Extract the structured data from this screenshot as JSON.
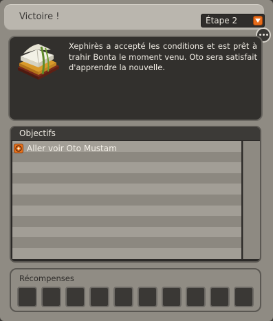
{
  "window": {
    "title": "Victoire !",
    "step_selected": "Étape 2",
    "more_icon": "ellipsis-icon",
    "accent": "#e8731d"
  },
  "description": {
    "icon": "book-icon",
    "text": "Xephirès a accepté les conditions et est prêt à trahir Bonta le moment venu. Oto sera satisfait d'apprendre la nouvelle."
  },
  "objectives": {
    "title": "Objectifs",
    "items": [
      {
        "label": "Aller voir Oto Mustam",
        "icon": "compass-icon"
      }
    ]
  },
  "rewards": {
    "title": "Récompenses",
    "slot_count": 10
  }
}
